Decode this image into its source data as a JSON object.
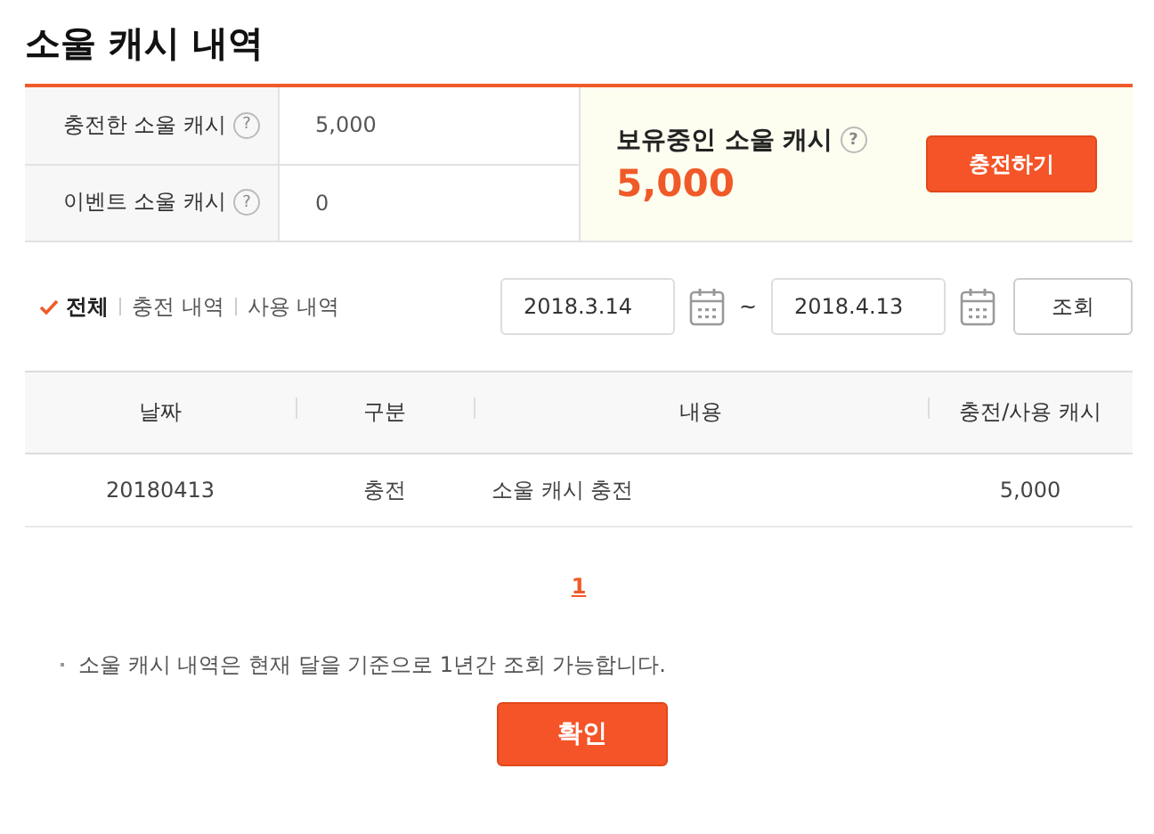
{
  "title": "소울 캐시 내역",
  "summary": {
    "rows": [
      {
        "label": "충전한 소울 캐시",
        "help": "?",
        "value": "5,000"
      },
      {
        "label": "이벤트 소울 캐시",
        "help": "?",
        "value": "0"
      }
    ],
    "balance": {
      "label": "보유중인 소울 캐시",
      "help": "?",
      "amount": "5,000"
    },
    "charge_button": "충전하기"
  },
  "filters": [
    {
      "label": "전체",
      "selected": true
    },
    {
      "label": "충전 내역",
      "selected": false
    },
    {
      "label": "사용 내역",
      "selected": false
    }
  ],
  "date_range": {
    "from": "2018.3.14",
    "separator": "~",
    "to": "2018.4.13",
    "search_button": "조회"
  },
  "table": {
    "columns": [
      "날짜",
      "구분",
      "내용",
      "충전/사용 캐시"
    ],
    "rows": [
      [
        "20180413",
        "충전",
        "소울 캐시 충전",
        "5,000"
      ]
    ]
  },
  "pagination": [
    {
      "label": "1",
      "selected": true
    }
  ],
  "note": "소울 캐시 내역은 현재 달을 기준으로 1년간 조회 가능합니다.",
  "confirm_button": "확인"
}
